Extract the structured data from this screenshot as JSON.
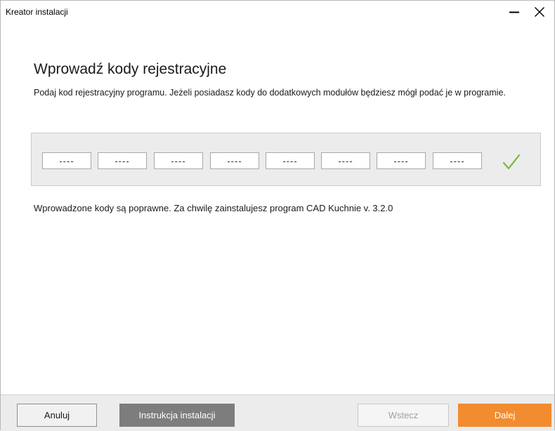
{
  "window": {
    "title": "Kreator instalacji"
  },
  "page": {
    "heading": "Wprowadź kody rejestracyjne",
    "description": "Podaj kod rejestracyjny programu. Jeżeli posiadasz kody do dodatkowych modułów będziesz mógł podać je w programie.",
    "status": "Wprowadzone kody są poprawne. Za chwilę zainstalujesz program CAD Kuchnie v. 3.2.0"
  },
  "codes": {
    "fields": [
      "----",
      "----",
      "----",
      "----",
      "----",
      "----",
      "----",
      "----"
    ],
    "valid": true
  },
  "footer": {
    "cancel_label": "Anuluj",
    "instructions_label": "Instrukcja instalacji",
    "back_label": "Wstecz",
    "next_label": "Dalej"
  },
  "colors": {
    "accent": "#f28c2f",
    "check": "#7ab541",
    "secondary_button": "#7d7d7d"
  },
  "icons": {
    "minimize": "minimize-icon",
    "close": "close-icon",
    "valid": "checkmark-icon"
  }
}
